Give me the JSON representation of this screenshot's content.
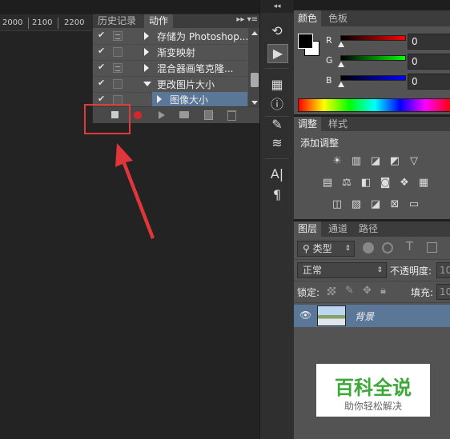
{
  "ruler": {
    "marks": [
      "2000",
      "2100",
      "2200"
    ]
  },
  "actions_panel": {
    "tabs": [
      "历史记录",
      "动作"
    ],
    "rows": [
      {
        "label": "存储为 Photoshop...",
        "checked": true,
        "expanded": false
      },
      {
        "label": "渐变映射",
        "checked": true,
        "expanded": false
      },
      {
        "label": "混合器画笔克隆...",
        "checked": true,
        "expanded": false
      },
      {
        "label": "更改图片大小",
        "checked": true,
        "expanded": true
      },
      {
        "label": "图像大小",
        "checked": true,
        "expanded": false,
        "selected": true
      }
    ],
    "toolbar": [
      "stop-icon",
      "record-icon",
      "play-icon",
      "folder-icon",
      "new-action-icon",
      "delete-icon"
    ],
    "menu_glyph": "▸▸ ▾≡"
  },
  "color_panel": {
    "tabs": [
      "颜色",
      "色板"
    ],
    "channels": [
      {
        "label": "R",
        "value": "0"
      },
      {
        "label": "G",
        "value": "0"
      },
      {
        "label": "B",
        "value": "0"
      }
    ]
  },
  "adjustments_panel": {
    "tabs": [
      "调整",
      "样式"
    ],
    "heading": "添加调整"
  },
  "layers_panel": {
    "tabs": [
      "图层",
      "通道",
      "路径"
    ],
    "filter_label": "类型",
    "blend_mode": "正常",
    "opacity_label": "不透明度:",
    "opacity_value": "10",
    "lock_label": "锁定:",
    "fill_label": "填充:",
    "fill_value": "10",
    "layers": [
      {
        "name": "背景",
        "visible": true
      }
    ]
  },
  "watermark": {
    "title": "百科全说",
    "subtitle": "助你轻松解决"
  },
  "collapse_glyph": "◂◂"
}
